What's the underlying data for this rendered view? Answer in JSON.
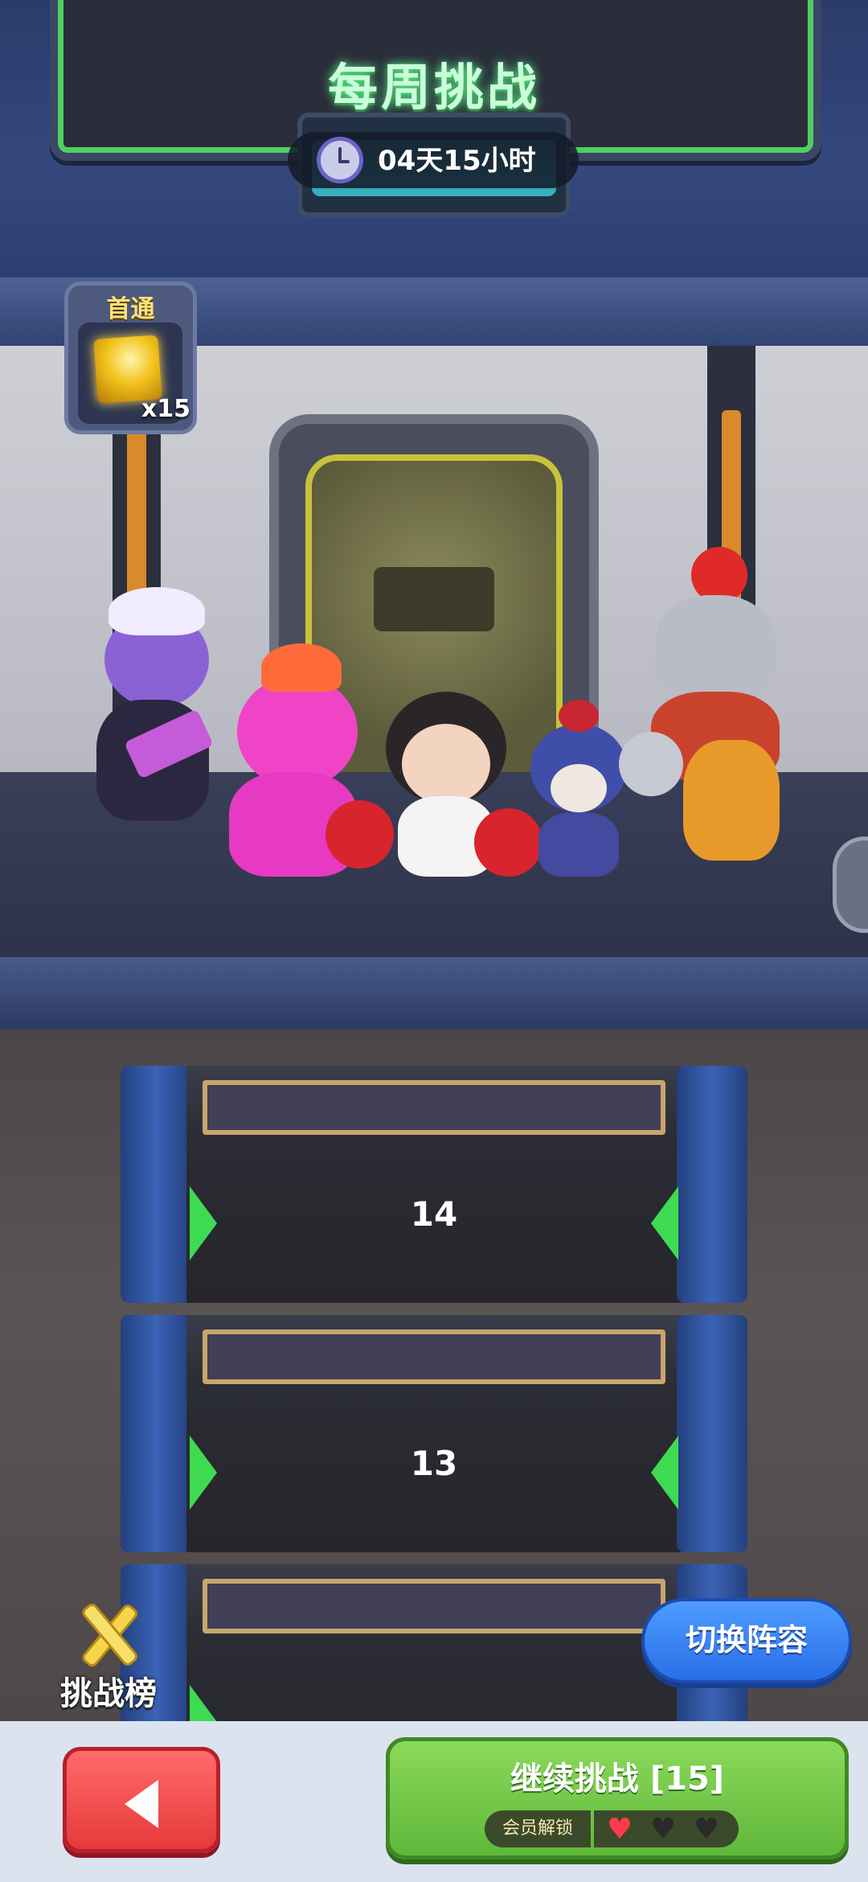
{
  "header": {
    "title": "每周挑战",
    "countdown": "04天15小时",
    "icon": "clock-icon"
  },
  "reward": {
    "label": "首通",
    "count": "x15",
    "icon": "gold-cube-icon"
  },
  "tower": {
    "floors": [
      "14",
      "13"
    ]
  },
  "leaderboard": {
    "label": "挑战榜",
    "icon": "crossed-swords-icon"
  },
  "switch_lineup": {
    "label": "切换阵容"
  },
  "bottom": {
    "back_icon": "back-arrow-icon",
    "continue_label": "继续挑战 [15]",
    "vip_label": "会员解锁",
    "hearts": [
      "full",
      "broken",
      "broken"
    ]
  },
  "colors": {
    "title_glow": "#5cff8a",
    "switch_button": "#2a6ee8",
    "continue_button": "#5fb83a",
    "back_button": "#e63a3a",
    "floor_arrow": "#3edb52"
  }
}
